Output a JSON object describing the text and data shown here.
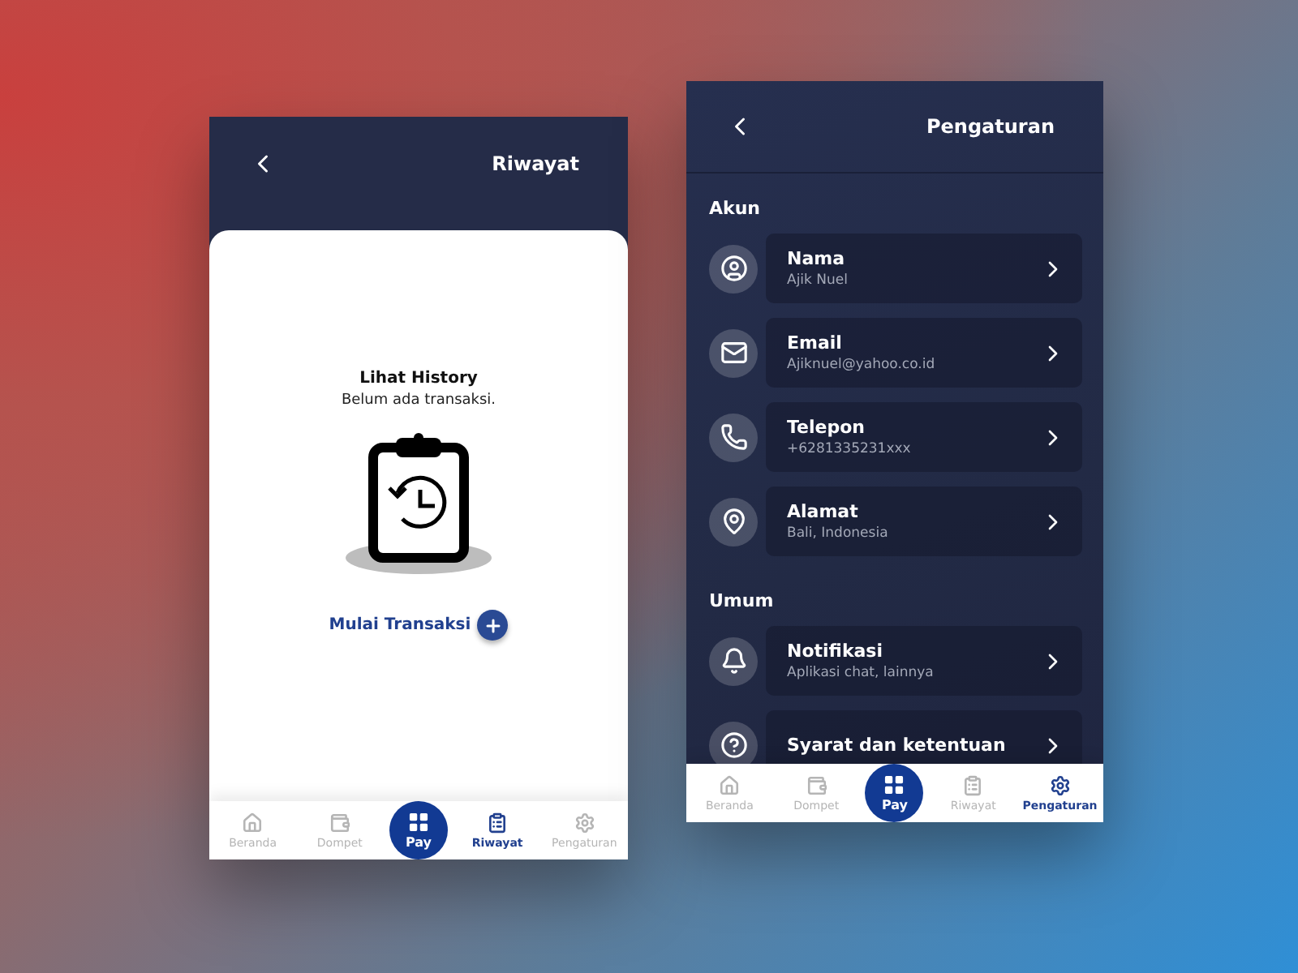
{
  "history_screen": {
    "header": {
      "title": "Riwayat"
    },
    "empty_state": {
      "title": "Lihat History",
      "message": "Belum ada transaksi.",
      "action": "Mulai Transaksi"
    },
    "nav": [
      {
        "label": "Beranda",
        "kind": "tab",
        "selected": false
      },
      {
        "label": "Dompet",
        "kind": "tab",
        "selected": false
      },
      {
        "label": "Pay",
        "kind": "pay",
        "selected": false
      },
      {
        "label": "Riwayat",
        "kind": "tab",
        "selected": true
      },
      {
        "label": "Pengaturan",
        "kind": "tab",
        "selected": false
      }
    ]
  },
  "settings_screen": {
    "header": {
      "title": "Pengaturan"
    },
    "sections": [
      {
        "title": "Akun",
        "items": [
          {
            "label": "Nama",
            "value": "Ajik Nuel"
          },
          {
            "label": "Email",
            "value": "Ajiknuel@yahoo.co.id"
          },
          {
            "label": "Telepon",
            "value": "+6281335231xxx"
          },
          {
            "label": "Alamat",
            "value": "Bali, Indonesia"
          }
        ]
      },
      {
        "title": "Umum",
        "items": [
          {
            "label": "Notifikasi",
            "value": "Aplikasi chat, lainnya"
          },
          {
            "label": "Syarat dan ketentuan"
          }
        ]
      }
    ],
    "nav": [
      {
        "label": "Beranda",
        "kind": "tab",
        "selected": false
      },
      {
        "label": "Dompet",
        "kind": "tab",
        "selected": false
      },
      {
        "label": "Pay",
        "kind": "pay",
        "selected": false
      },
      {
        "label": "Riwayat",
        "kind": "tab",
        "selected": false
      },
      {
        "label": "Pengaturan",
        "kind": "tab",
        "selected": true
      }
    ]
  }
}
